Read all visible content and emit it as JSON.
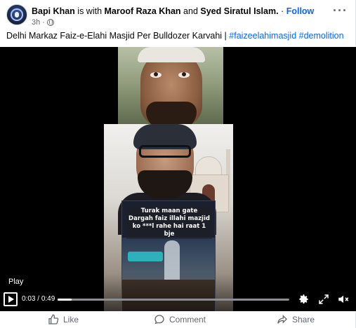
{
  "post": {
    "author": "Bapi Khan",
    "with_text": "is with",
    "tagged_1": "Maroof Raza Khan",
    "and_text": "and",
    "tagged_2": "Syed Siratul Islam.",
    "dot": "·",
    "follow_label": "Follow",
    "time": "3h",
    "dot2": "·",
    "more_icon": "more-horizontal-icon",
    "privacy_icon": "globe-icon"
  },
  "caption": {
    "text": "Delhi Markaz Faiz-e-Elahi Masjid Per Bulldozer Karvahi |",
    "hashtag_1": "#faizeelahimasjid",
    "hashtag_2": "#demolition"
  },
  "video": {
    "overlay_text": "Turak maan gate Dargah faiz illahi mazjid ko ***l rahe hai raat 1 bje",
    "play_tooltip": "Play",
    "current_time": "0:03",
    "separator": "/",
    "duration": "0:49",
    "progress": 0.061,
    "icons": [
      "play-icon",
      "settings-icon",
      "fullscreen-icon",
      "volume-muted-icon"
    ]
  },
  "actions": {
    "like_label": "Like",
    "comment_label": "Comment",
    "share_label": "Share"
  },
  "colors": {
    "link": "#0866ff",
    "muted": "#65676b",
    "text": "#050505"
  }
}
